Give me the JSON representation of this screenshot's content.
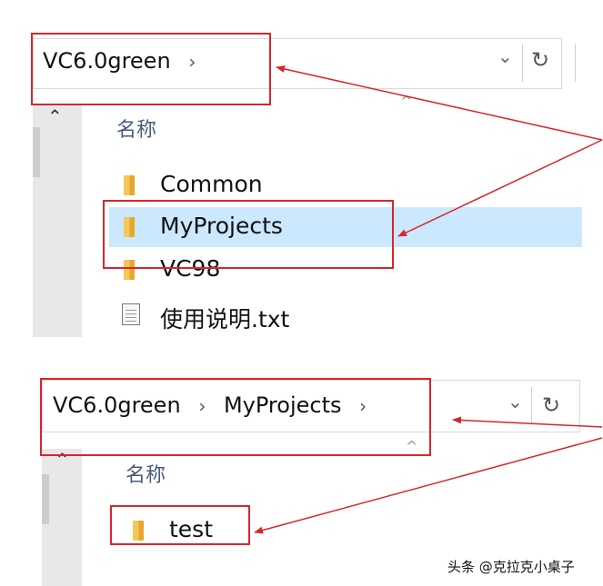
{
  "panel1": {
    "breadcrumb": [
      "VC6.0green"
    ],
    "separator": "›",
    "dropdown_icon": "chevron-down-icon",
    "refresh_icon": "refresh-icon",
    "column_header": "名称",
    "items": [
      {
        "name": "Common",
        "type": "folder",
        "selected": false
      },
      {
        "name": "MyProjects",
        "type": "folder",
        "selected": true
      },
      {
        "name": "VC98",
        "type": "folder",
        "selected": false
      },
      {
        "name": "使用说明.txt",
        "type": "text-file",
        "selected": false
      }
    ]
  },
  "panel2": {
    "breadcrumb": [
      "VC6.0green",
      "MyProjects"
    ],
    "separator": "›",
    "dropdown_icon": "chevron-down-icon",
    "refresh_icon": "refresh-icon",
    "column_header": "名称",
    "items": [
      {
        "name": "test",
        "type": "folder",
        "selected": false
      }
    ]
  },
  "glyphs": {
    "chevron_down": "⌄",
    "refresh": "↻",
    "scroll_up": "⌃",
    "sort_up": "^"
  },
  "annotation_color": "#d6272b",
  "selection_color": "#cce8ff",
  "watermark": "头条 @克拉克小桌子"
}
